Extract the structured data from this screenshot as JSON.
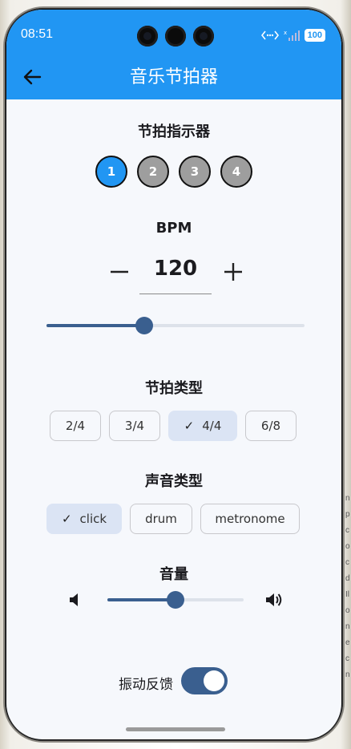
{
  "status_bar": {
    "time": "08:51",
    "battery": "100"
  },
  "app_bar": {
    "title": "音乐节拍器"
  },
  "beat_indicator": {
    "label": "节拍指示器",
    "beats": [
      {
        "label": "1",
        "active": true
      },
      {
        "label": "2",
        "active": false
      },
      {
        "label": "3",
        "active": false
      },
      {
        "label": "4",
        "active": false
      }
    ]
  },
  "bpm": {
    "label": "BPM",
    "value": "120",
    "slider_fraction": 0.38
  },
  "time_signature": {
    "label": "节拍类型",
    "options": [
      "2/4",
      "3/4",
      "4/4",
      "6/8"
    ],
    "selected": "4/4"
  },
  "sound_type": {
    "label": "声音类型",
    "options": [
      "click",
      "drum",
      "metronome"
    ],
    "selected": "click"
  },
  "volume": {
    "label": "音量",
    "slider_fraction": 0.5
  },
  "vibration": {
    "label": "振动反馈",
    "enabled": true
  },
  "colors": {
    "primary": "#2196f3",
    "accent": "#3a5f8f",
    "chip_selected": "#dbe4f4",
    "inactive_beat": "#9e9e9e"
  }
}
